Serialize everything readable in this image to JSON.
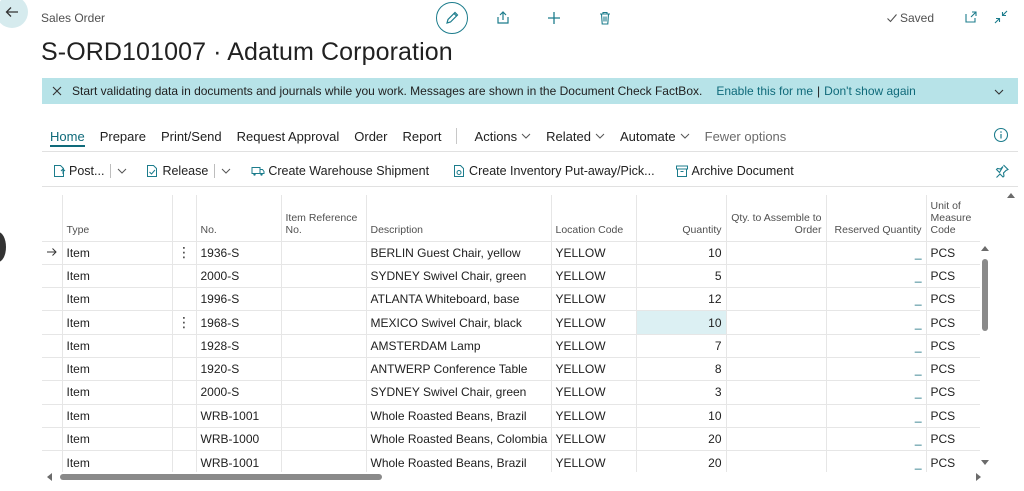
{
  "header": {
    "breadcrumb": "Sales Order",
    "title": "S-ORD101007 · Adatum Corporation",
    "saved_label": "Saved"
  },
  "banner": {
    "message": "Start validating data in documents and journals while you work. Messages are shown in the Document Check FactBox.",
    "enable_link": "Enable this for me",
    "separator": "|",
    "dismiss_link": "Don't show again"
  },
  "menu": {
    "home": "Home",
    "prepare": "Prepare",
    "print_send": "Print/Send",
    "request_approval": "Request Approval",
    "order": "Order",
    "report": "Report",
    "actions": "Actions",
    "related": "Related",
    "automate": "Automate",
    "fewer_options": "Fewer options"
  },
  "toolbar": {
    "post": "Post...",
    "release": "Release",
    "create_warehouse_shipment": "Create Warehouse Shipment",
    "create_inventory_putaway": "Create Inventory Put-away/Pick...",
    "archive_document": "Archive Document"
  },
  "grid": {
    "columns": {
      "type": "Type",
      "no": "No.",
      "item_reference_no": "Item Reference No.",
      "description": "Description",
      "location_code": "Location Code",
      "quantity": "Quantity",
      "qty_to_assemble": "Qty. to Assemble to Order",
      "reserved_quantity": "Reserved Quantity",
      "unit_of_measure": "Unit of Measure Code"
    },
    "rows": [
      {
        "type": "Item",
        "no": "1936-S",
        "ref": "",
        "description": "BERLIN Guest Chair, yellow",
        "location": "YELLOW",
        "quantity": "10",
        "assemble": "",
        "reserved": "_",
        "uom": "PCS"
      },
      {
        "type": "Item",
        "no": "2000-S",
        "ref": "",
        "description": "SYDNEY Swivel Chair, green",
        "location": "YELLOW",
        "quantity": "5",
        "assemble": "",
        "reserved": "_",
        "uom": "PCS"
      },
      {
        "type": "Item",
        "no": "1996-S",
        "ref": "",
        "description": "ATLANTA Whiteboard, base",
        "location": "YELLOW",
        "quantity": "12",
        "assemble": "",
        "reserved": "_",
        "uom": "PCS"
      },
      {
        "type": "Item",
        "no": "1968-S",
        "ref": "",
        "description": "MEXICO Swivel Chair, black",
        "location": "YELLOW",
        "quantity": "10",
        "assemble": "",
        "reserved": "_",
        "uom": "PCS"
      },
      {
        "type": "Item",
        "no": "1928-S",
        "ref": "",
        "description": "AMSTERDAM Lamp",
        "location": "YELLOW",
        "quantity": "7",
        "assemble": "",
        "reserved": "_",
        "uom": "PCS"
      },
      {
        "type": "Item",
        "no": "1920-S",
        "ref": "",
        "description": "ANTWERP Conference Table",
        "location": "YELLOW",
        "quantity": "8",
        "assemble": "",
        "reserved": "_",
        "uom": "PCS"
      },
      {
        "type": "Item",
        "no": "2000-S",
        "ref": "",
        "description": "SYDNEY Swivel Chair, green",
        "location": "YELLOW",
        "quantity": "3",
        "assemble": "",
        "reserved": "_",
        "uom": "PCS"
      },
      {
        "type": "Item",
        "no": "WRB-1001",
        "ref": "",
        "description": "Whole Roasted Beans, Brazil",
        "location": "YELLOW",
        "quantity": "10",
        "assemble": "",
        "reserved": "_",
        "uom": "PCS"
      },
      {
        "type": "Item",
        "no": "WRB-1000",
        "ref": "",
        "description": "Whole Roasted Beans, Colombia",
        "location": "YELLOW",
        "quantity": "20",
        "assemble": "",
        "reserved": "_",
        "uom": "PCS"
      },
      {
        "type": "Item",
        "no": "WRB-1001",
        "ref": "",
        "description": "Whole Roasted Beans, Brazil",
        "location": "YELLOW",
        "quantity": "20",
        "assemble": "",
        "reserved": "_",
        "uom": "PCS"
      }
    ]
  },
  "colors": {
    "accent": "#0f6a7a",
    "banner_bg": "#b7e3e8",
    "selected_cell": "#dcf0f3"
  }
}
